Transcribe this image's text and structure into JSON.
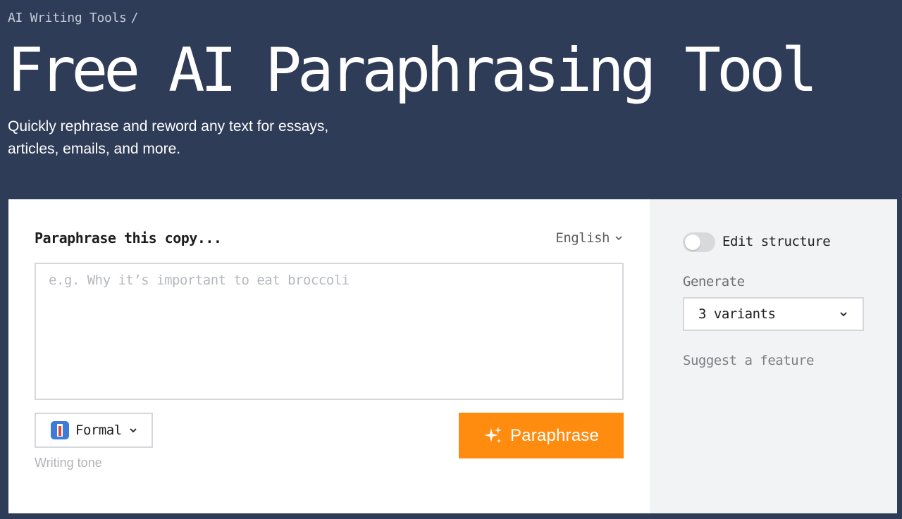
{
  "breadcrumb": {
    "item": "AI Writing Tools",
    "separator": "/"
  },
  "header": {
    "title": "Free AI Paraphrasing Tool",
    "subtitle": "Quickly rephrase and reword any text for essays, articles, emails, and more."
  },
  "editor": {
    "label": "Paraphrase this copy...",
    "language": "English",
    "placeholder": "e.g. Why it’s important to eat broccoli",
    "value": ""
  },
  "tone": {
    "selected": "Formal",
    "caption": "Writing tone",
    "icon": "necktie-icon"
  },
  "action": {
    "button_label": "Paraphrase",
    "icon": "sparkle-icon",
    "color": "#ff8b0f"
  },
  "options": {
    "edit_structure_label": "Edit structure",
    "edit_structure_on": false,
    "generate_label": "Generate",
    "variants_selected": "3 variants",
    "suggest_link": "Suggest a feature"
  },
  "colors": {
    "header_bg": "#2f3c57",
    "accent": "#ff8b0f",
    "side_panel_bg": "#f2f3f5"
  }
}
